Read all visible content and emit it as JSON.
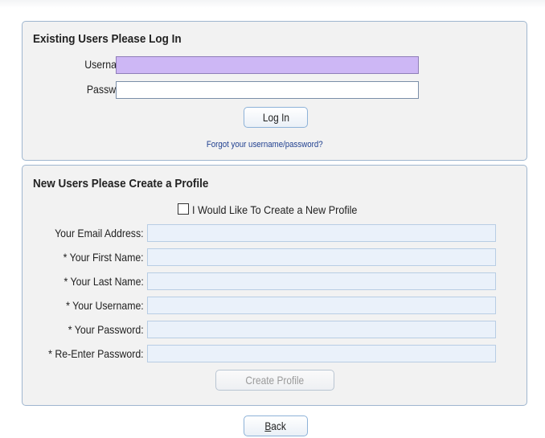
{
  "login_panel": {
    "title": "Existing Users Please Log In",
    "username_label": "Username:",
    "username_value": "",
    "password_label": "Password:",
    "password_value": "",
    "login_button": "Log In",
    "forgot_link": "Forgot your username/password?"
  },
  "create_panel": {
    "title": "New Users Please Create a Profile",
    "checkbox_label": "I Would Like To Create a New Profile",
    "checkbox_checked": false,
    "fields": [
      {
        "label": "Your Email Address:",
        "value": ""
      },
      {
        "label": "* Your First Name:",
        "value": ""
      },
      {
        "label": "* Your Last Name:",
        "value": ""
      },
      {
        "label": "* Your Username:",
        "value": ""
      },
      {
        "label": "* Your Password:",
        "value": ""
      },
      {
        "label": "* Re-Enter Password:",
        "value": ""
      }
    ],
    "create_button": "Create Profile"
  },
  "back_button": {
    "accesskey_letter": "B",
    "rest": "ack"
  },
  "colors": {
    "panel_border": "#9fb6cf",
    "panel_background": "#f2f2f2",
    "focused_field": "#cdb7f5",
    "create_field_background": "#eaf1fa",
    "link": "#1f3f8f"
  }
}
